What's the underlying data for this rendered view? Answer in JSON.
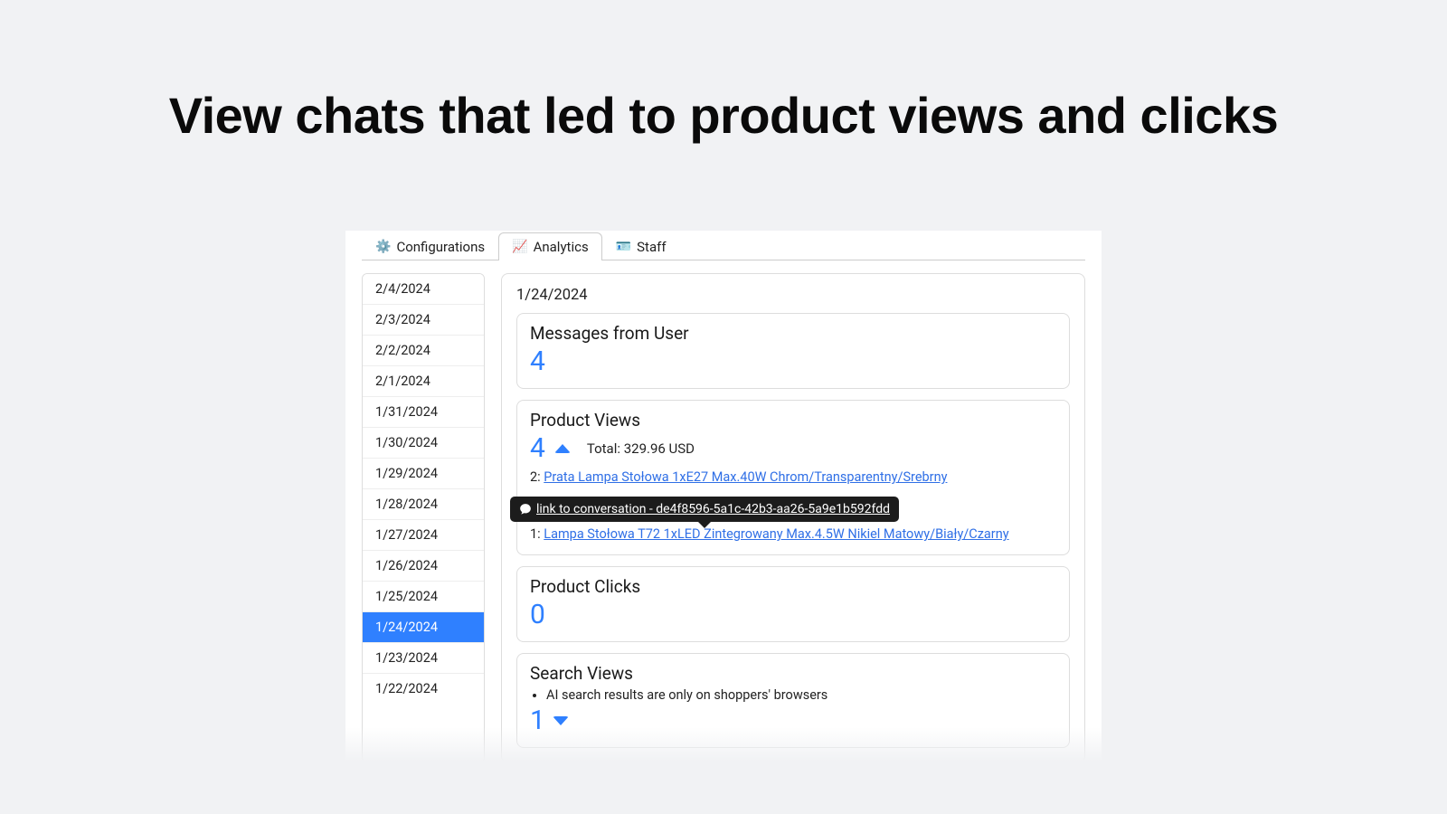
{
  "headline": "View chats that led to product views and clicks",
  "tabs": {
    "config": {
      "icon": "⚙️",
      "label": "Configurations"
    },
    "analytics": {
      "icon": "📈",
      "label": "Analytics"
    },
    "staff": {
      "icon": "🪪",
      "label": "Staff"
    }
  },
  "dates": [
    "2/4/2024",
    "2/3/2024",
    "2/2/2024",
    "2/1/2024",
    "1/31/2024",
    "1/30/2024",
    "1/29/2024",
    "1/28/2024",
    "1/27/2024",
    "1/26/2024",
    "1/25/2024",
    "1/24/2024",
    "1/23/2024",
    "1/22/2024"
  ],
  "selected_date": "1/24/2024",
  "panel": {
    "date_heading": "1/24/2024",
    "messages": {
      "title": "Messages from User",
      "value": "4"
    },
    "product_views": {
      "title": "Product Views",
      "value": "4",
      "total_label": "Total: 329.96 USD",
      "item1_prefix": "2: ",
      "item1_link": "Prata Lampa Stołowa 1xE27 Max.40W Chrom/Transparentny/Srebrny",
      "item2_prefix": "1: ",
      "item2_link": "Lampa Stołowa T72 1xLED Zintegrowany Max.4.5W Nikiel Matowy/Biały/Czarny"
    },
    "tooltip": "link to conversation - de4f8596-5a1c-42b3-aa26-5a9e1b592fdd",
    "product_clicks": {
      "title": "Product Clicks",
      "value": "0"
    },
    "search_views": {
      "title": "Search Views",
      "note": "AI search results are only on shoppers' browsers",
      "value": "1"
    }
  }
}
